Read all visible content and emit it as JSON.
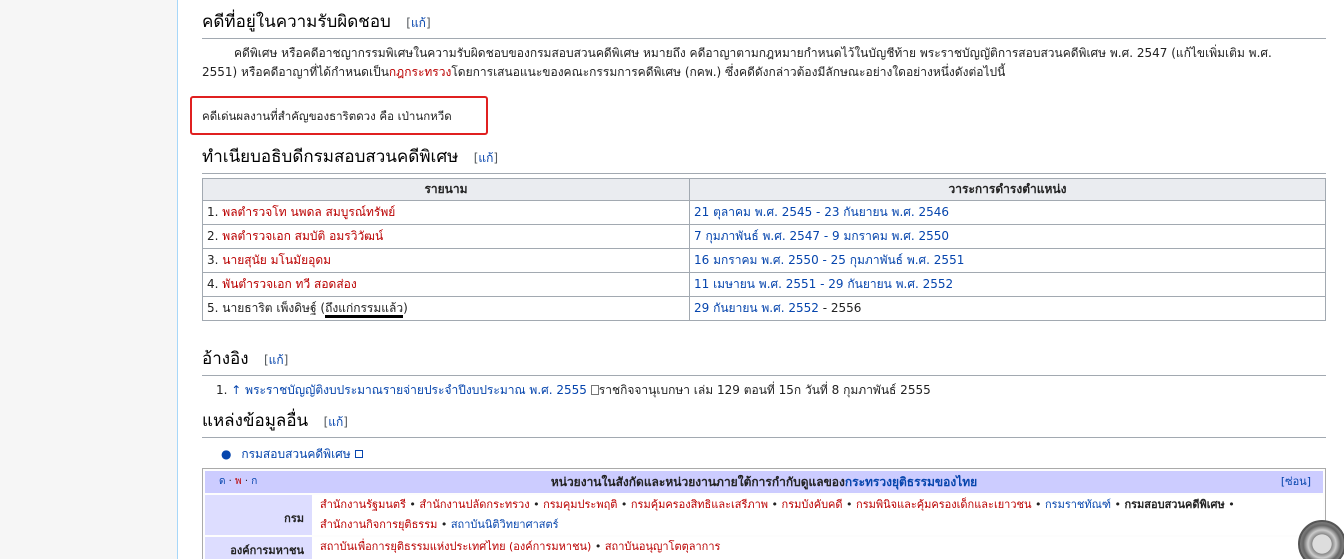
{
  "sections": {
    "responsibility": {
      "heading": "คดีที่อยู่ในความรับผิดชอบ",
      "edit": "แก้"
    },
    "directors": {
      "heading": "ทำเนียบอธิบดีกรมสอบสวนคดีพิเศษ",
      "edit": "แก้"
    },
    "references": {
      "heading": "อ้างอิง",
      "edit": "แก้"
    },
    "external": {
      "heading": "แหล่งข้อมูลอื่น",
      "edit": "แก้"
    }
  },
  "paragraph": {
    "line1": "คดีพิเศษ หรือคดีอาชญากรรมพิเศษในความรับผิดชอบของกรมสอบสวนคดีพิเศษ หมายถึง คดีอาญาตามกฎหมายกำหนดไว้ในบัญชีท้าย พระราชบัญญัติการสอบสวนคดีพิเศษ พ.ศ. 2547 (แก้ไขเพิ่มเติม พ.ศ.",
    "line2_a": "2551) หรือคดีอาญาที่ได้กำหนดเป็น",
    "line2_link": "กฎกระทรวง",
    "line2_b": "โดยการเสนอแนะของคณะกรรมการคดีพิเศษ (กคพ.) ซึ่งคดีดังกล่าวต้องมีลักษณะอย่างใดอย่างหนึ่งดังต่อไปนี้"
  },
  "callout": "คดีเด่นผลงานที่สำคัญของธาริตดวง คือ เป่านกหวีด",
  "table": {
    "headers": [
      "รายนาม",
      "วาระการดำรงตำแหน่ง"
    ],
    "rows": [
      {
        "num": "1.",
        "name": "พลตำรวจโท นพดล สมบูรณ์ทรัพย์",
        "term": "21 ตุลาคม พ.ศ. 2545 - 23 กันยายน พ.ศ. 2546"
      },
      {
        "num": "2.",
        "name": "พลตำรวจเอก สมบัติ อมรวิวัฒน์",
        "term": "7 กุมภาพันธ์ พ.ศ. 2547 - 9 มกราคม พ.ศ. 2550"
      },
      {
        "num": "3.",
        "name": "นายสุนัย มโนมัยอุดม",
        "term": "16 มกราคม พ.ศ. 2550 - 25 กุมภาพันธ์ พ.ศ. 2551"
      },
      {
        "num": "4.",
        "name": "พันตำรวจเอก ทวี สอดส่อง",
        "term": "11 เมษายน พ.ศ. 2551 - 29 กันยายน พ.ศ. 2552"
      }
    ],
    "row5": {
      "num": "5.",
      "name": "นายธาริต เพ็งดิษฐ์",
      "note": "ถึงแก่กรรมแล้ว",
      "term_link": "29 กันยายน พ.ศ. 2552",
      "term_rest": " - 2556"
    }
  },
  "refs": {
    "num": "1.",
    "arrow": "↑",
    "link": "พระราชบัญญัติงบประมาณรายจ่ายประจำปีงบประมาณ พ.ศ. 2555",
    "rest": "ราชกิจจานุเบกษา เล่ม 129 ตอนที่ 15ก วันที่ 8 กุมภาพันธ์ 2555"
  },
  "external": {
    "bullet": "●",
    "link": "กรมสอบสวนคดีพิเศษ"
  },
  "navbox": {
    "vde": [
      "ด",
      "พ",
      "ก"
    ],
    "title_a": "หน่วยงานในสังกัดและหน่วยงานภายใต้การกำกับดูแลของ",
    "title_link": "กระทรวงยุติธรรมของไทย",
    "hide": "[ซ่อน]",
    "row1_group": "กรม",
    "row1_items": [
      "สำนักงานรัฐมนตรี",
      "สำนักงานปลัดกระทรวง",
      "กรมคุมประพฤติ",
      "กรมคุ้มครองสิทธิและเสรีภาพ",
      "กรมบังคับคดี",
      "กรมพินิจและคุ้มครองเด็กและเยาวชน",
      "กรมราชทัณฑ์"
    ],
    "row1_bold": "กรมสอบสวนคดีพิเศษ",
    "row1_line2": [
      "สำนักงานกิจการยุติธรรม",
      "สถาบันนิติวิทยาศาสตร์"
    ],
    "row2_group": "องค์การมหาชน",
    "row2_items": [
      "สถาบันเพื่อการยุติธรรมแห่งประเทศไทย (องค์การมหาชน)",
      "สถาบันอนุญาโตตุลาการ"
    ]
  }
}
